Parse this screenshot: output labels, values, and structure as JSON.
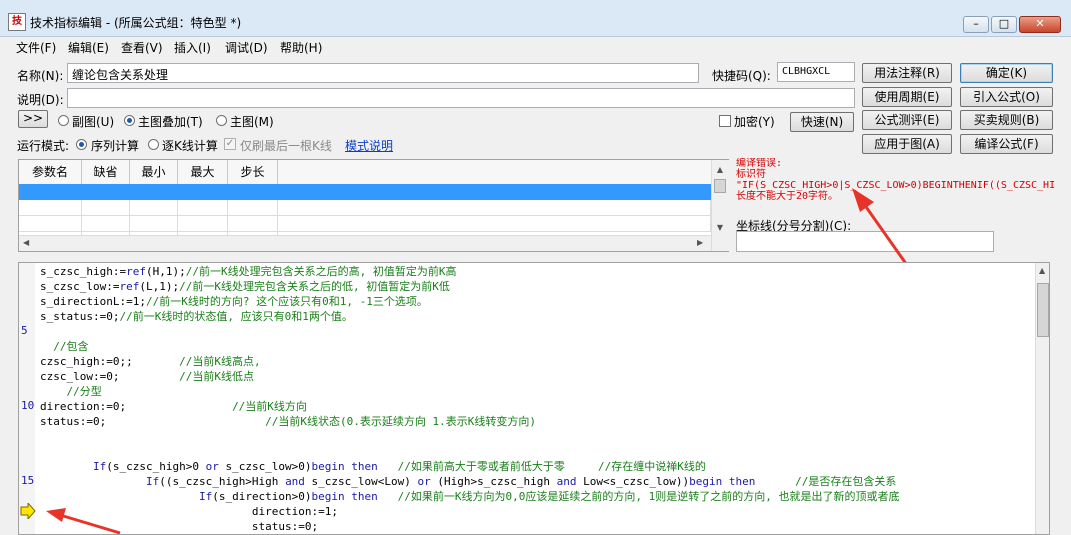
{
  "window": {
    "title": "技术指标编辑 - (所属公式组：特色型 *)",
    "app_icon_glyph": "技"
  },
  "menu": [
    "文件(F)",
    "编辑(E)",
    "查看(V)",
    "插入(I)",
    "调试(D)",
    "帮助(H)"
  ],
  "form": {
    "name_label": "名称(N):",
    "name_value": "缠论包含关系处理",
    "shortcut_label": "快捷码(Q):",
    "shortcut_value": "CLBHGXCL",
    "desc_label": "说明(D):",
    "desc_value": "",
    "expand_btn": ">>",
    "chart_types": [
      {
        "label": "副图(U)",
        "selected": false
      },
      {
        "label": "主图叠加(T)",
        "selected": true
      },
      {
        "label": "主图(M)",
        "selected": false
      }
    ],
    "encrypt_label": "加密(Y)",
    "fast_btn": "快速(N)",
    "run_mode_label": "运行模式:",
    "run_modes": [
      {
        "label": "序列计算",
        "selected": true
      },
      {
        "label": "逐K线计算",
        "selected": false
      }
    ],
    "only_last_label": "仅刷最后一根K线",
    "mode_help_link": "模式说明"
  },
  "buttons": {
    "usage_note": "用法注释(R)",
    "ok": "确定(K)",
    "usage_period": "使用周期(E)",
    "import_formula": "引入公式(O)",
    "formula_test": "公式测评(E)",
    "buy_sell_rules": "买卖规则(B)",
    "apply_to_chart": "应用于图(A)",
    "compile_formula": "编译公式(F)"
  },
  "param_table": {
    "headers": [
      "参数名",
      "缺省",
      "最小",
      "最大",
      "步长"
    ]
  },
  "compile_error": {
    "line1": "编译错误:",
    "line2": "标识符",
    "line3": "\"IF(S_CZSC_HIGH>0|S_CZSC_LOW>0)BEGINTHENIF((S_CZSC_HI",
    "line4": "长度不能大于20字符。"
  },
  "baseline": {
    "label": "坐标线(分号分割)(C):",
    "value": ""
  },
  "editor": {
    "line_numbers": [
      "5",
      "10",
      "15"
    ],
    "code_lines": [
      {
        "code": "s_czsc_high:=ref(H,1);",
        "comment": "//前一K线处理完包含关系之后的高, 初值暂定为前K高"
      },
      {
        "code": "s_czsc_low:=ref(L,1);",
        "comment": "//前一K线处理完包含关系之后的低, 初值暂定为前K低"
      },
      {
        "code": "s_directionL:=1;",
        "comment": "//前一K线时的方向? 这个应该只有0和1, -1三个选项。"
      },
      {
        "code": "s_status:=0;",
        "comment": "//前一K线时的状态值, 应该只有0和1两个值。"
      },
      {
        "code": "",
        "comment": ""
      },
      {
        "code": "  ",
        "comment": "//包含"
      },
      {
        "code": "czsc_high:=0;;       ",
        "comment": "//当前K线高点,"
      },
      {
        "code": "czsc_low:=0;         ",
        "comment": "//当前K线低点"
      },
      {
        "code": "    ",
        "comment": "//分型"
      },
      {
        "code": "direction:=0;                ",
        "comment": "//当前K线方向"
      },
      {
        "code": "status:=0;                        ",
        "comment": "//当前K线状态(0.表示延续方向 1.表示K线转变方向)"
      },
      {
        "code": "",
        "comment": ""
      },
      {
        "code": "",
        "comment": ""
      },
      {
        "code": "        If(s_czsc_high>0 or s_czsc_low>0)begin then   ",
        "comment": "//如果前高大于零或者前低大于零     //存在缠中说禅K线的"
      },
      {
        "code": "                If((s_czsc_high>High and s_czsc_low<Low) or (High>s_czsc_high and Low<s_czsc_low))begin then      ",
        "comment": "//是否存在包含关系"
      },
      {
        "code": "                        If(s_direction>0)begin then   ",
        "comment": "//如果前一K线方向为0,0应该是延续之前的方向, 1则是逆转了之前的方向, 也就是出了新的顶或者底"
      },
      {
        "code": "                                direction:=1;",
        "comment": ""
      },
      {
        "code": "                                status:=0;",
        "comment": ""
      }
    ]
  }
}
